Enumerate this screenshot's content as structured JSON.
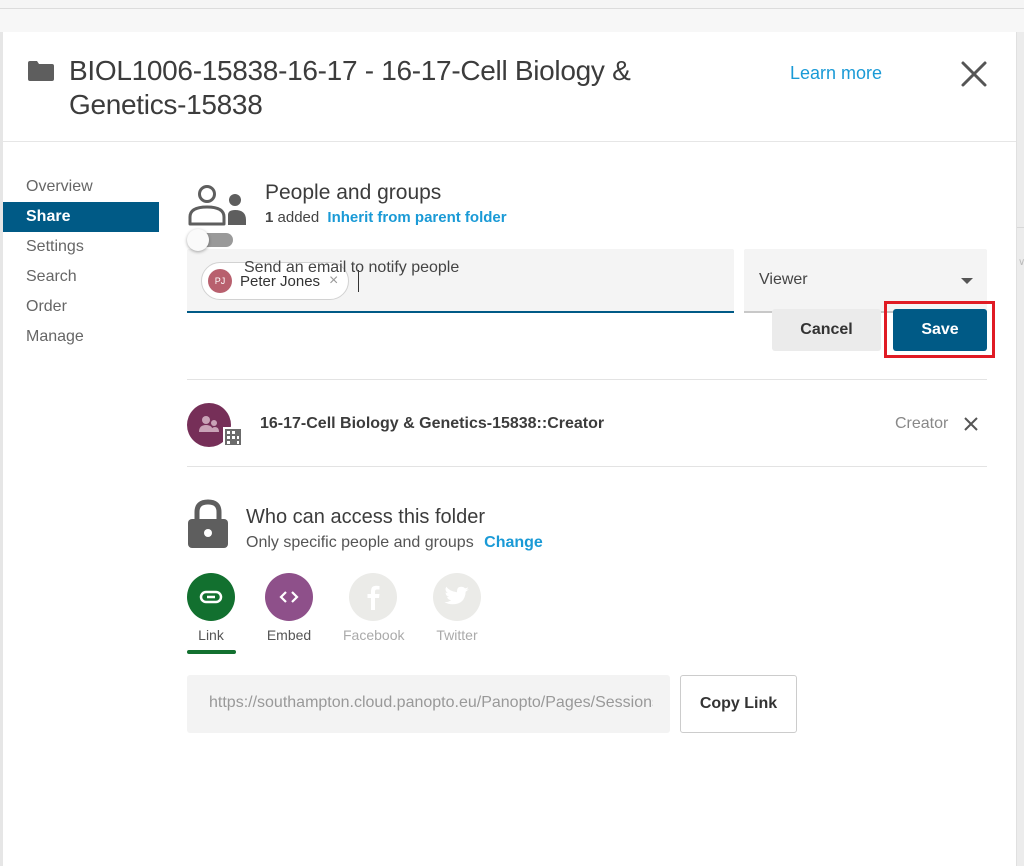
{
  "dialog": {
    "title": "BIOL1006-15838-16-17 - 16-17-Cell Biology & Genetics-15838",
    "learn_more": "Learn more",
    "icons": {
      "folder": "folder-icon",
      "close": "close-icon"
    }
  },
  "nav": {
    "items": [
      {
        "label": "Overview",
        "active": false
      },
      {
        "label": "Share",
        "active": true
      },
      {
        "label": "Settings",
        "active": false
      },
      {
        "label": "Search",
        "active": false
      },
      {
        "label": "Order",
        "active": false
      },
      {
        "label": "Manage",
        "active": false
      }
    ]
  },
  "people": {
    "title": "People and groups",
    "added_count": "1",
    "added_label": "added",
    "inherit_link": "Inherit from parent folder",
    "chip": {
      "initials": "PJ",
      "name": "Peter Jones",
      "remove": "×",
      "avatar_color": "#b8606e"
    },
    "input_value": "",
    "role_select": {
      "selected": "Viewer"
    },
    "notify_toggle": {
      "label": "Send an email to notify people",
      "on": false
    },
    "cancel_label": "Cancel",
    "save_label": "Save"
  },
  "members": [
    {
      "name": "16-17-Cell Biology & Genetics-15838::Creator",
      "role": "Creator",
      "avatar_color": "#762f58"
    }
  ],
  "access": {
    "title": "Who can access this folder",
    "description": "Only specific people and groups",
    "change_link": "Change"
  },
  "share_options": [
    {
      "label": "Link",
      "icon": "link-icon",
      "color": "#12702f",
      "enabled": true,
      "selected": true
    },
    {
      "label": "Embed",
      "icon": "embed-icon",
      "color": "#8e508a",
      "enabled": true,
      "selected": false
    },
    {
      "label": "Facebook",
      "icon": "facebook-icon",
      "color": "#ebebe8",
      "enabled": false,
      "selected": false
    },
    {
      "label": "Twitter",
      "icon": "twitter-icon",
      "color": "#ebebe8",
      "enabled": false,
      "selected": false
    }
  ],
  "link": {
    "url": "https://southampton.cloud.panopto.eu/Panopto/Pages/Sessions/List.aspx",
    "copy_label": "Copy Link"
  },
  "colors": {
    "primary": "#005a86",
    "link": "#1a9ad6",
    "highlight": "#e01b24"
  }
}
